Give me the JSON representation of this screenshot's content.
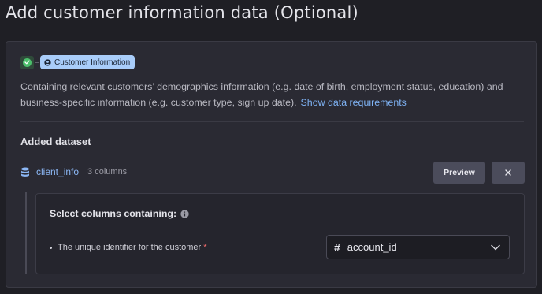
{
  "page": {
    "title": "Add customer information data (Optional)"
  },
  "step": {
    "pill_label": "Customer Information",
    "status": "complete"
  },
  "description": {
    "text": "Containing relevant customers’ demographics information (e.g. date of birth, employment status, education) and business-specific information (e.g. customer type, sign up date).",
    "link_label": "Show data requirements"
  },
  "added_dataset": {
    "heading": "Added dataset",
    "name": "client_info",
    "columns_label": "3 columns",
    "preview_label": "Preview",
    "remove_glyph": "×"
  },
  "column_mapping": {
    "heading": "Select columns containing:",
    "fields": [
      {
        "label": "The unique identifier for the customer",
        "required_mark": "*",
        "type_glyph": "#",
        "selected_value": "account_id"
      }
    ]
  },
  "icons": [
    "check-icon",
    "person-icon",
    "database-icon",
    "close-icon",
    "info-icon",
    "chevron-down-icon"
  ],
  "colors": {
    "background": "#1f1f25",
    "card": "#2a2a33",
    "accent_link": "#7fb3f5",
    "pill": "#a9cdfa",
    "success": "#4bbf6b",
    "required": "#ef6b6b"
  }
}
